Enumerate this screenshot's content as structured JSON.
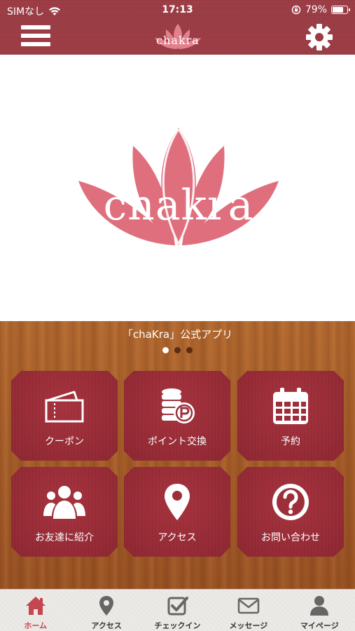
{
  "status_bar": {
    "carrier": "SIMなし",
    "time": "17:13",
    "battery": "79%",
    "battery_level": 0.79,
    "icons": [
      "wifi-icon",
      "orientation-lock-icon",
      "battery-icon"
    ]
  },
  "header": {
    "logo_text": "chakra",
    "icons": [
      "hamburger-menu-icon",
      "gear-icon"
    ],
    "bar_color": "#9b3a43"
  },
  "hero": {
    "logo_text": "chakra",
    "logo_color": "#e06f7e"
  },
  "caption": "「chaKra」公式アプリ",
  "carousel": {
    "page_count": 3,
    "active_index": 0
  },
  "tiles": [
    {
      "label": "クーポン",
      "icon": "ticket-icon"
    },
    {
      "label": "ポイント交換",
      "icon": "coins-point-icon"
    },
    {
      "label": "予約",
      "icon": "calendar-icon"
    },
    {
      "label": "お友達に紹介",
      "icon": "users-icon"
    },
    {
      "label": "アクセス",
      "icon": "map-pin-icon"
    },
    {
      "label": "お問い合わせ",
      "icon": "question-circle-icon"
    }
  ],
  "tabbar": {
    "active_color": "#c4464e",
    "tabs": [
      {
        "label": "ホーム",
        "icon": "home-icon",
        "active": true
      },
      {
        "label": "アクセス",
        "icon": "map-pin-icon",
        "active": false
      },
      {
        "label": "チェックイン",
        "icon": "checkbox-icon",
        "active": false
      },
      {
        "label": "メッセージ",
        "icon": "envelope-icon",
        "active": false
      },
      {
        "label": "マイページ",
        "icon": "user-icon",
        "active": false
      }
    ]
  }
}
